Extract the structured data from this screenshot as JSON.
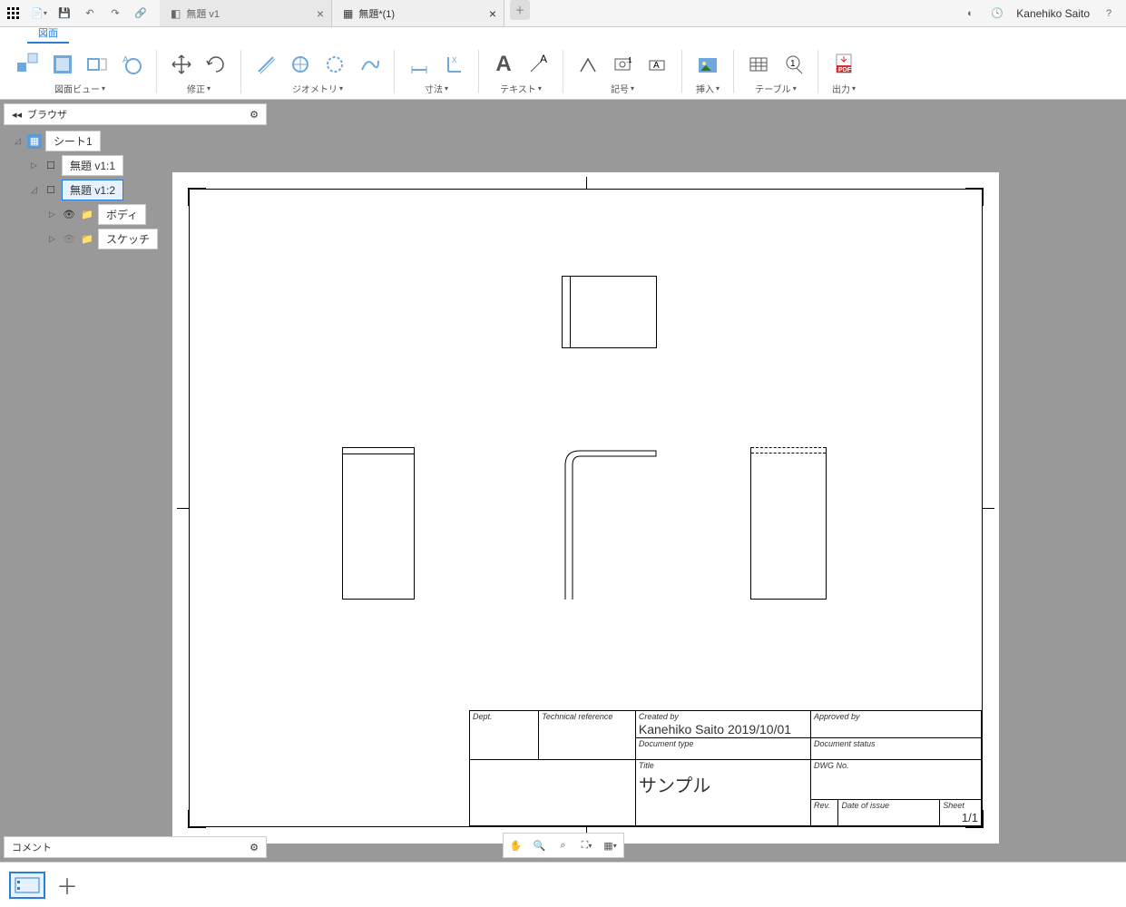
{
  "tabs": {
    "inactive": "無題 v1",
    "active": "無題*(1)"
  },
  "user": "Kanehiko Saito",
  "ribbon": {
    "active_tab": "図面"
  },
  "toolbar": {
    "view": "図面ビュー",
    "modify": "修正",
    "geometry": "ジオメトリ",
    "dimension": "寸法",
    "text": "テキスト",
    "symbol": "記号",
    "insert": "挿入",
    "table": "テーブル",
    "output": "出力"
  },
  "browser": {
    "title": "ブラウザ",
    "sheet": "シート1",
    "items": [
      "無題 v1:1",
      "無題 v1:2",
      "ボディ",
      "スケッチ"
    ]
  },
  "comment": {
    "title": "コメント"
  },
  "titleblock": {
    "dept": "Dept.",
    "techref": "Technical reference",
    "createdby": "Created by",
    "createdby_val": "Kanehiko Saito 2019/10/01",
    "approvedby": "Approved by",
    "doctype": "Document type",
    "docstatus": "Document status",
    "title": "Title",
    "title_val": "サンプル",
    "dwgno": "DWG No.",
    "rev": "Rev.",
    "dateissue": "Date of issue",
    "sheet": "Sheet",
    "sheet_val": "1/1"
  }
}
